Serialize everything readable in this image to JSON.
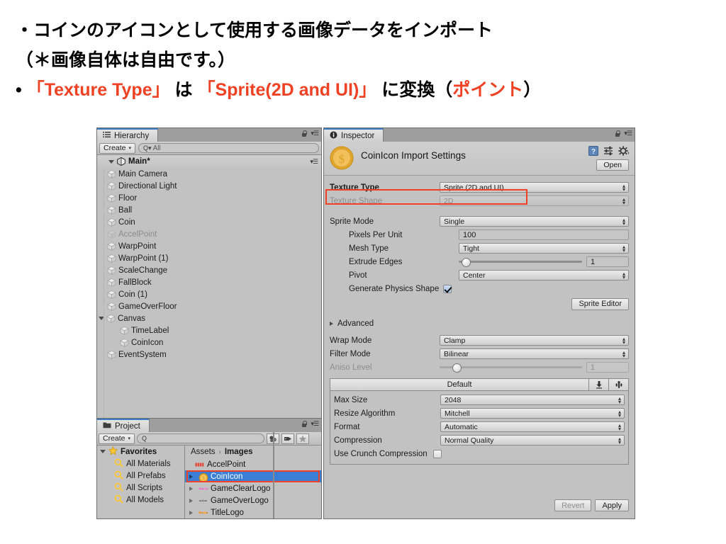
{
  "slide": {
    "lines": [
      {
        "id": "l1",
        "parts": [
          {
            "t": "・コインのアイコンとして使用する画像データをインポート",
            "c": "black"
          }
        ]
      },
      {
        "id": "l2",
        "parts": [
          {
            "t": "（＊画像自体は自由です。）",
            "c": "black"
          }
        ]
      },
      {
        "id": "l3",
        "parts": [
          {
            "t": "•  ",
            "c": "black"
          },
          {
            "t": "「Texture Type」",
            "c": "red"
          },
          {
            "t": " は ",
            "c": "black"
          },
          {
            "t": "「Sprite(2D and UI)」",
            "c": "red"
          },
          {
            "t": " に変換（",
            "c": "black"
          },
          {
            "t": "ポイント",
            "c": "red"
          },
          {
            "t": "）",
            "c": "black"
          }
        ]
      }
    ],
    "accent_color": "#ef4123"
  },
  "hierarchy": {
    "tab_label": "Hierarchy",
    "create_label": "Create",
    "search_placeholder": "All",
    "scene_name": "Main*",
    "items": [
      {
        "label": "Main Camera",
        "indent": 2,
        "dim": false,
        "expandable": false
      },
      {
        "label": "Directional Light",
        "indent": 2,
        "dim": false,
        "expandable": false
      },
      {
        "label": "Floor",
        "indent": 2,
        "dim": false,
        "expandable": false
      },
      {
        "label": "Ball",
        "indent": 2,
        "dim": false,
        "expandable": false
      },
      {
        "label": "Coin",
        "indent": 2,
        "dim": false,
        "expandable": false
      },
      {
        "label": "AccelPoint",
        "indent": 2,
        "dim": true,
        "expandable": false
      },
      {
        "label": "WarpPoint",
        "indent": 2,
        "dim": false,
        "expandable": false
      },
      {
        "label": "WarpPoint (1)",
        "indent": 2,
        "dim": false,
        "expandable": false
      },
      {
        "label": "ScaleChange",
        "indent": 2,
        "dim": false,
        "expandable": false
      },
      {
        "label": "FallBlock",
        "indent": 2,
        "dim": false,
        "expandable": false
      },
      {
        "label": "Coin (1)",
        "indent": 2,
        "dim": false,
        "expandable": false
      },
      {
        "label": "GameOverFloor",
        "indent": 2,
        "dim": false,
        "expandable": false
      },
      {
        "label": "Canvas",
        "indent": 2,
        "dim": false,
        "expandable": true
      },
      {
        "label": "TimeLabel",
        "indent": 3,
        "dim": false,
        "expandable": false
      },
      {
        "label": "CoinIcon",
        "indent": 3,
        "dim": false,
        "expandable": false
      },
      {
        "label": "EventSystem",
        "indent": 2,
        "dim": false,
        "expandable": false
      }
    ]
  },
  "project": {
    "tab_label": "Project",
    "create_label": "Create",
    "search_placeholder": "",
    "favorites": {
      "label": "Favorites",
      "children": [
        "All Materials",
        "All Prefabs",
        "All Scripts",
        "All Models"
      ]
    },
    "breadcrumb": {
      "root": "Assets",
      "separator": "›",
      "current": "Images"
    },
    "assets": [
      {
        "label": "AccelPoint",
        "selected": false,
        "expandable": false,
        "icon": "accelpoint-thumb"
      },
      {
        "label": "CoinIcon",
        "selected": true,
        "expandable": true,
        "icon": "coin-thumb"
      },
      {
        "label": "GameClearLogo",
        "selected": false,
        "expandable": true,
        "icon": "gameclearlogo-thumb"
      },
      {
        "label": "GameOverLogo",
        "selected": false,
        "expandable": true,
        "icon": "gameoverlogo-thumb"
      },
      {
        "label": "TitleLogo",
        "selected": false,
        "expandable": true,
        "icon": "titlelogo-thumb"
      }
    ],
    "selection_highlight_color": "#ef4123",
    "selection_row_color": "#3a7fd5"
  },
  "inspector": {
    "tab_label": "Inspector",
    "title": "CoinIcon Import Settings",
    "open_label": "Open",
    "texture_type": {
      "label": "Texture Type",
      "value": "Sprite (2D and UI)",
      "highlighted": true
    },
    "texture_shape": {
      "label": "Texture Shape",
      "value": "2D",
      "disabled": true
    },
    "sprite_mode": {
      "label": "Sprite Mode",
      "value": "Single"
    },
    "pixels_per_unit": {
      "label": "Pixels Per Unit",
      "value": "100"
    },
    "mesh_type": {
      "label": "Mesh Type",
      "value": "Tight"
    },
    "extrude_edges": {
      "label": "Extrude Edges",
      "value": "1",
      "slider_pct": 2
    },
    "pivot": {
      "label": "Pivot",
      "value": "Center"
    },
    "generate_physics_shape": {
      "label": "Generate Physics Shape",
      "checked": true
    },
    "sprite_editor_label": "Sprite Editor",
    "advanced_label": "Advanced",
    "wrap_mode": {
      "label": "Wrap Mode",
      "value": "Clamp"
    },
    "filter_mode": {
      "label": "Filter Mode",
      "value": "Bilinear"
    },
    "aniso_level": {
      "label": "Aniso Level",
      "value": "1",
      "disabled": true,
      "slider_pct": 5
    },
    "platform": {
      "tab_label": "Default",
      "rows": [
        {
          "label": "Max Size",
          "value": "2048",
          "type": "dropdown"
        },
        {
          "label": "Resize Algorithm",
          "value": "Mitchell",
          "type": "dropdown"
        },
        {
          "label": "Format",
          "value": "Automatic",
          "type": "dropdown"
        },
        {
          "label": "Compression",
          "value": "Normal Quality",
          "type": "dropdown"
        },
        {
          "label": "Use Crunch Compression",
          "value": "",
          "type": "checkbox",
          "checked": false
        }
      ]
    },
    "revert_label": "Revert",
    "apply_label": "Apply"
  }
}
